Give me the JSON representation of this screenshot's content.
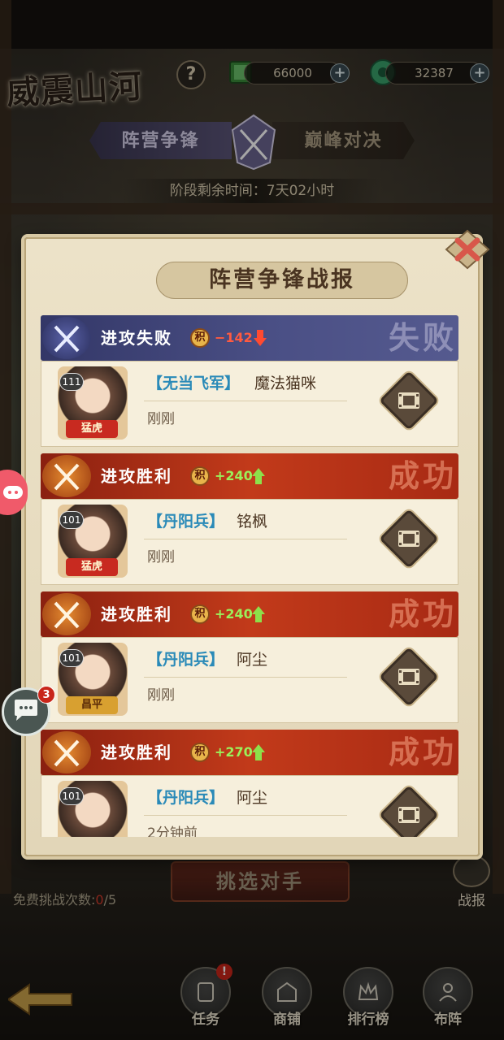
{
  "header": {
    "logo_text": "威震山河",
    "help_label": "?",
    "resources": [
      {
        "icon": "green-book-icon",
        "value": "66000"
      },
      {
        "icon": "jade-coin-icon",
        "value": "32387"
      }
    ],
    "plus_label": "+"
  },
  "mode_tabs": [
    {
      "label": "阵营争锋",
      "active": true
    },
    {
      "label": "巅峰对决",
      "active": false
    }
  ],
  "phase_time": "阶段剩余时间：7天02小时",
  "modal": {
    "title": "阵营争锋战报",
    "close_icon": "close-x-icon",
    "reports": [
      {
        "result": "fail",
        "result_label": "进攻失败",
        "score_icon_text": "积",
        "score": "−142",
        "trend": "down",
        "stamp": "失败",
        "level": "111",
        "avatar_tag": "猛虎",
        "faction": "【无当飞军】",
        "player": "魔法猫咪",
        "time": "刚刚"
      },
      {
        "result": "win",
        "result_label": "进攻胜利",
        "score_icon_text": "积",
        "score": "+240",
        "trend": "up",
        "stamp": "成功",
        "level": "101",
        "avatar_tag": "猛虎",
        "faction": "【丹阳兵】",
        "player": "铭枫",
        "time": "刚刚"
      },
      {
        "result": "win",
        "result_label": "进攻胜利",
        "score_icon_text": "积",
        "score": "+240",
        "trend": "up",
        "stamp": "成功",
        "level": "101",
        "avatar_tag": "昌平",
        "faction": "【丹阳兵】",
        "player": "阿尘",
        "time": "刚刚"
      },
      {
        "result": "win",
        "result_label": "进攻胜利",
        "score_icon_text": "积",
        "score": "+270",
        "trend": "up",
        "stamp": "成功",
        "level": "101",
        "avatar_tag": "",
        "faction": "【丹阳兵】",
        "player": "阿尘",
        "time": "2分钟前"
      }
    ]
  },
  "bottom": {
    "challenge_button": "挑选对手",
    "free_label": "免费挑战次数:",
    "free_used": "0",
    "free_total": "/5",
    "battle_report_label": "战报",
    "nav": [
      {
        "label": "任务",
        "icon": "scroll-icon"
      },
      {
        "label": "商铺",
        "icon": "shop-icon"
      },
      {
        "label": "排行榜",
        "icon": "crown-icon"
      },
      {
        "label": "布阵",
        "icon": "formation-icon"
      }
    ],
    "task_alert": "!"
  },
  "chat": {
    "badge": "3"
  },
  "colors": {
    "fail_banner": "#4a4f85",
    "win_banner": "#c23a1a",
    "faction_text": "#2a8ab8",
    "score_up": "#9bf05a",
    "score_down": "#ff5a40"
  }
}
